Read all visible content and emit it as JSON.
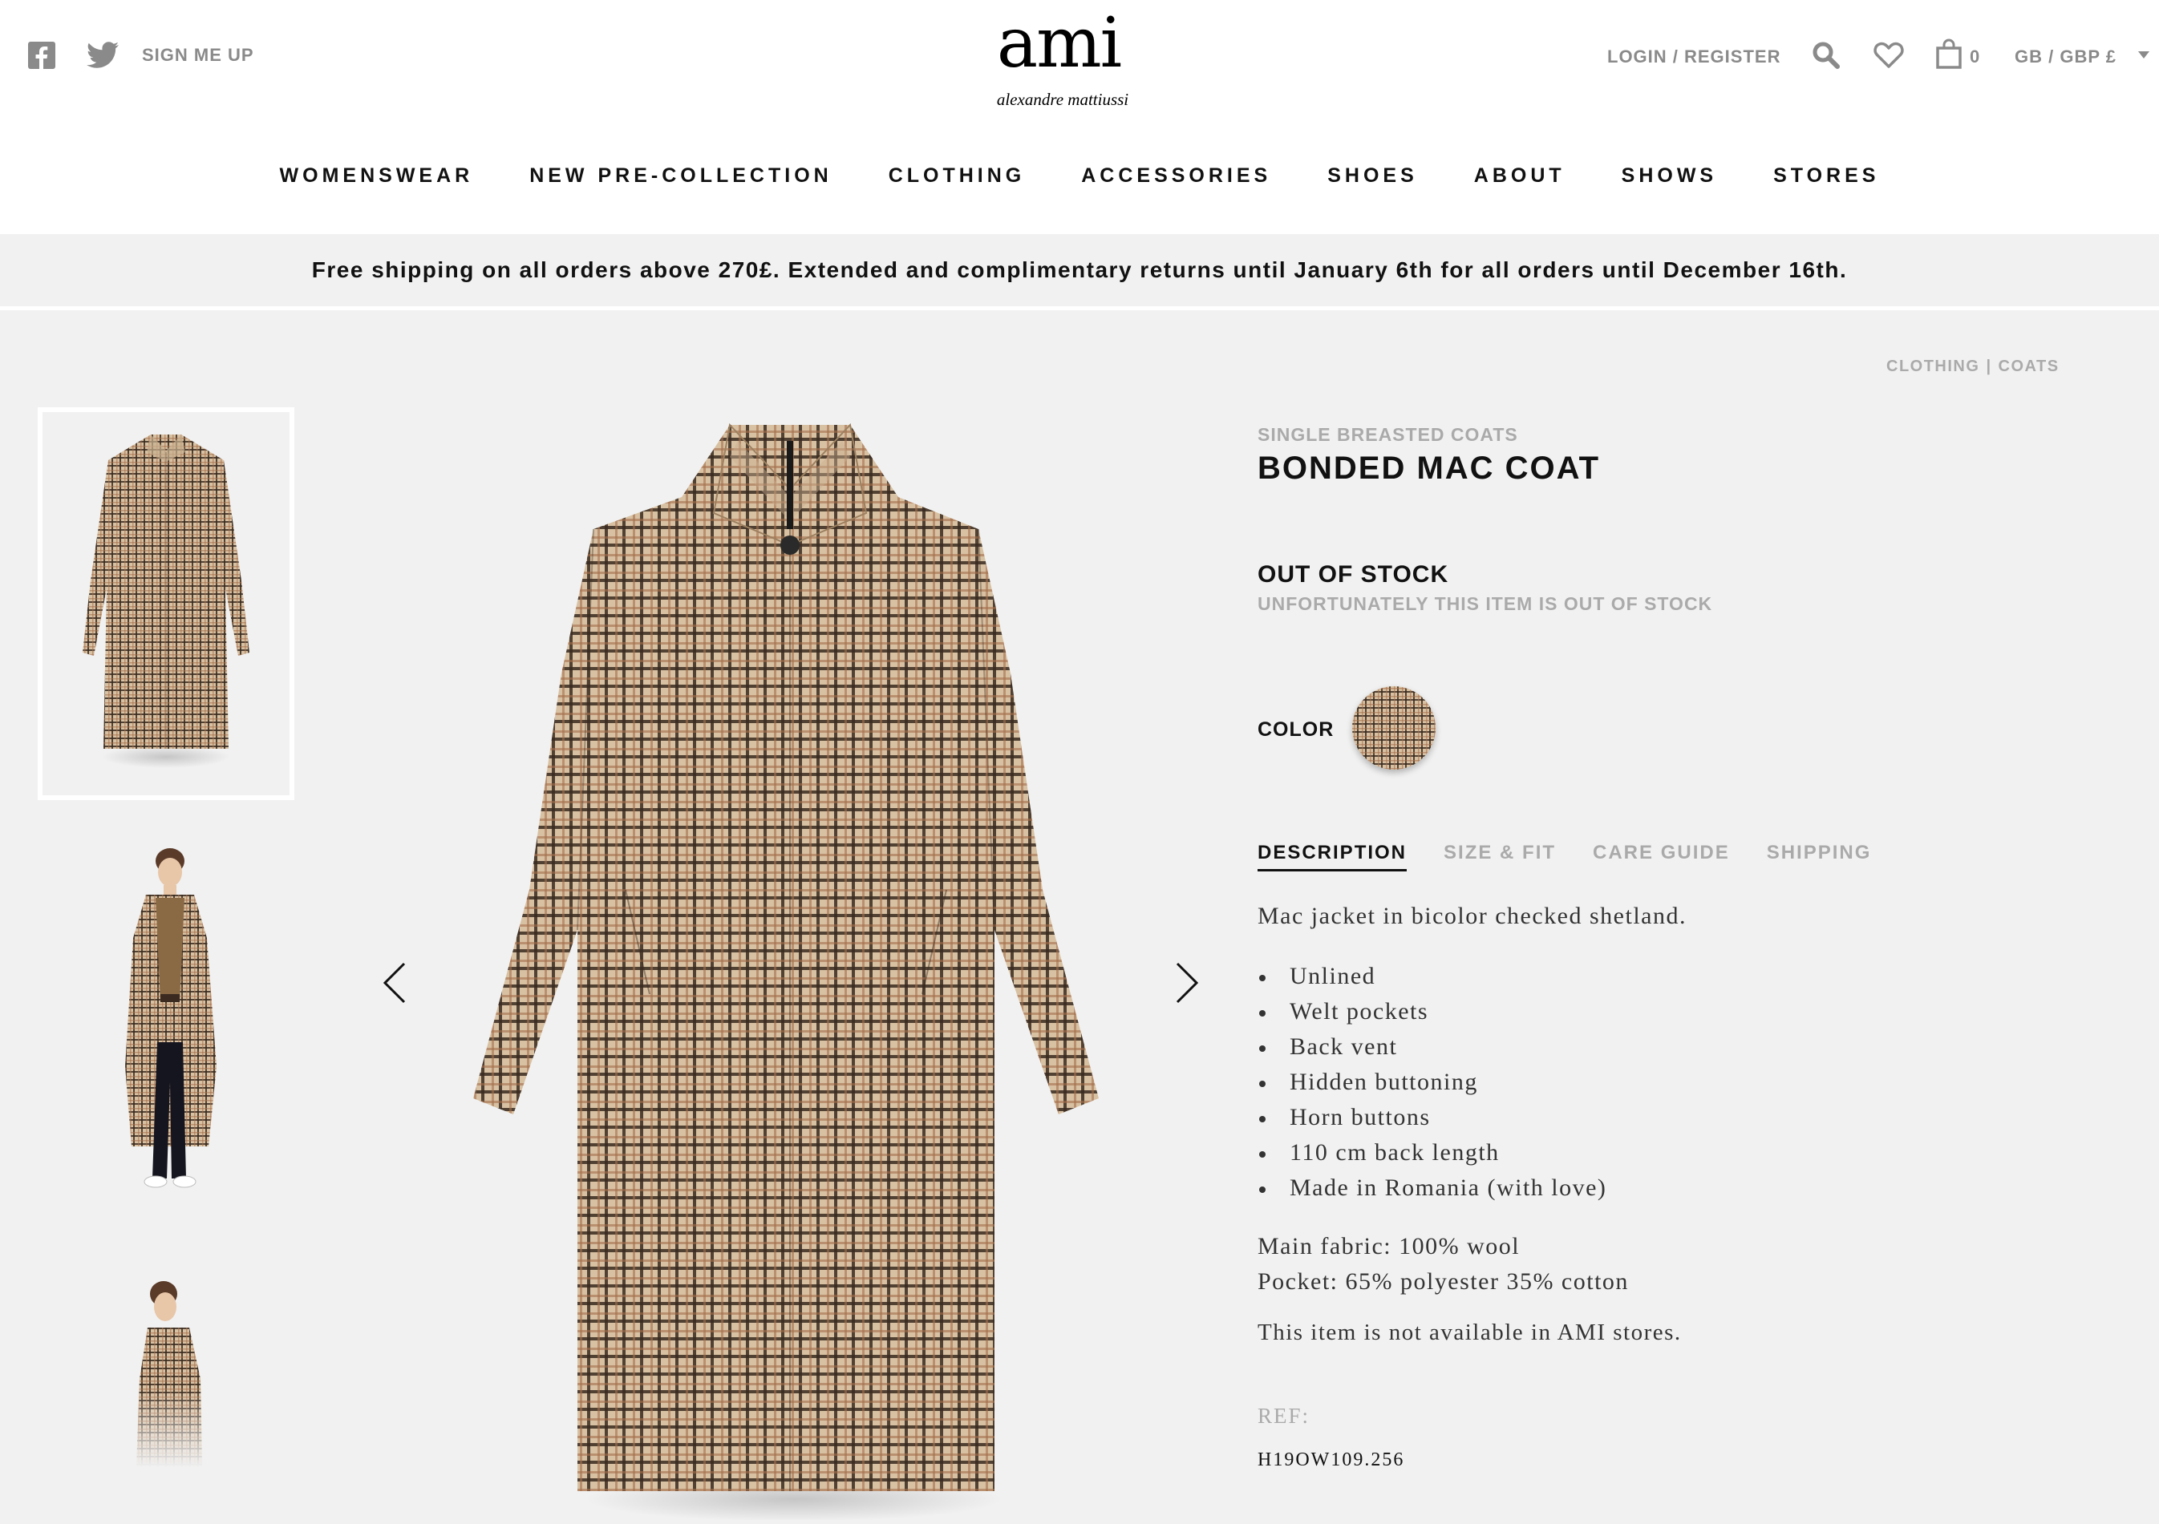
{
  "header": {
    "social": {
      "facebook_icon": "facebook-icon",
      "twitter_icon": "twitter-icon"
    },
    "signup_label": "SIGN ME UP",
    "logo": {
      "main": "ami",
      "sub": "alexandre mattiussi"
    },
    "login_label": "LOGIN / REGISTER",
    "cart_count": "0",
    "locale": "GB / GBP £"
  },
  "nav": {
    "items": [
      "WOMENSWEAR",
      "NEW PRE-COLLECTION",
      "CLOTHING",
      "ACCESSORIES",
      "SHOES",
      "ABOUT",
      "SHOWS",
      "STORES"
    ]
  },
  "banner": {
    "text": "Free shipping on all orders above 270£. Extended and complimentary returns until January 6th for all orders until December 16th."
  },
  "breadcrumb": {
    "items": [
      "CLOTHING",
      "COATS"
    ],
    "separator": "|"
  },
  "product": {
    "category": "SINGLE BREASTED COATS",
    "title": "BONDED MAC COAT",
    "stock_title": "OUT OF STOCK",
    "stock_message": "UNFORTUNATELY THIS ITEM IS OUT OF STOCK",
    "color_label": "COLOR",
    "tabs": [
      "DESCRIPTION",
      "SIZE & FIT",
      "CARE GUIDE",
      "SHIPPING"
    ],
    "active_tab": 0,
    "description": "Mac jacket in bicolor checked shetland.",
    "features": [
      "Unlined",
      "Welt pockets",
      "Back vent",
      "Hidden buttoning",
      "Horn buttons",
      "110 cm back length",
      "Made in Romania (with love)"
    ],
    "fabric_main": "Main fabric: 100% wool",
    "fabric_pocket": "Pocket: 65% polyester 35% cotton",
    "availability": "This item is not available in AMI stores.",
    "ref_label": "REF:",
    "ref_value": "H19OW109.256"
  },
  "colors": {
    "page_bg": "#f1f1f1",
    "header_bg": "#ffffff",
    "text_dark": "#111111",
    "text_muted": "#aaaaaa",
    "check_base": "#d8c1a2",
    "check_dark": "#3a2a20",
    "check_rust": "#a5704d"
  }
}
